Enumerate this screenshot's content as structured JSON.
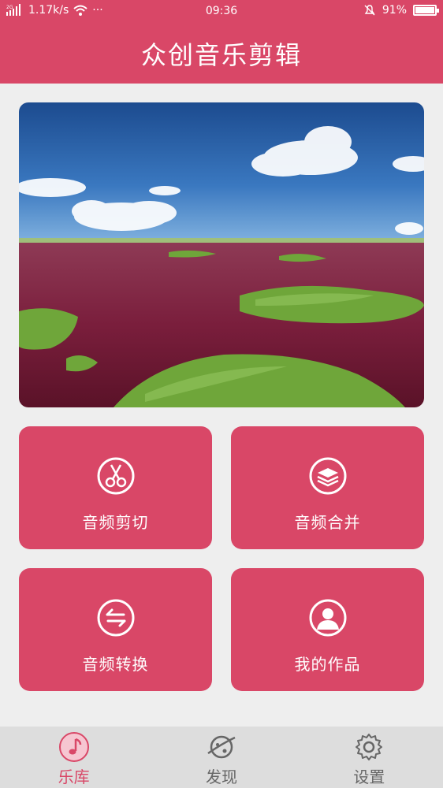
{
  "status_bar": {
    "network": "2G",
    "speed": "1.17k/s",
    "more": "···",
    "time": "09:36",
    "battery_text": "91%",
    "battery_level": 0.91
  },
  "header": {
    "title": "众创音乐剪辑"
  },
  "tiles": [
    {
      "label": "音频剪切",
      "icon": "scissors-icon"
    },
    {
      "label": "音频合并",
      "icon": "layers-icon"
    },
    {
      "label": "音频转换",
      "icon": "swap-arrows-icon"
    },
    {
      "label": "我的作品",
      "icon": "user-icon"
    }
  ],
  "tab_bar": {
    "items": [
      {
        "label": "乐库",
        "icon": "music-note-icon",
        "active": true
      },
      {
        "label": "发现",
        "icon": "planet-icon",
        "active": false
      },
      {
        "label": "设置",
        "icon": "gear-icon",
        "active": false
      }
    ]
  },
  "colors": {
    "brand": "#d94767",
    "tab_inactive": "#666666",
    "background": "#eeeeee"
  }
}
